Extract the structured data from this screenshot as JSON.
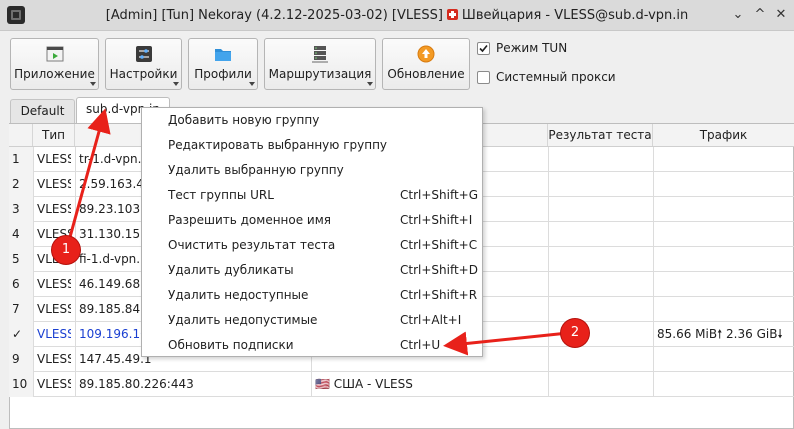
{
  "window": {
    "title_prefix": "[Admin] [Tun] Nekoray (4.2.12-2025-03-02) [VLESS]",
    "title_suffix": "Швейцария - VLESS@sub.d-vpn.in",
    "flag_icon": "swiss-flag-icon",
    "controls": [
      "⌄",
      "^",
      "✕"
    ]
  },
  "toolbar": {
    "buttons": [
      {
        "label": "Приложение",
        "icon": "application-icon",
        "dropdown": true
      },
      {
        "label": "Настройки",
        "icon": "settings-icon",
        "dropdown": true
      },
      {
        "label": "Профили",
        "icon": "profiles-folder-icon",
        "dropdown": true
      },
      {
        "label": "Маршрутизация",
        "icon": "routing-server-icon",
        "dropdown": true
      },
      {
        "label": "Обновление",
        "icon": "update-icon",
        "dropdown": false
      }
    ],
    "tun_mode": {
      "label": "Режим TUN",
      "checked": true
    },
    "system_proxy": {
      "label": "Системный прокси",
      "checked": false
    }
  },
  "tabs": [
    {
      "label": "Default",
      "active": false
    },
    {
      "label": "sub.d-vpn.in",
      "active": true
    }
  ],
  "table": {
    "columns": [
      "Тип",
      "",
      "",
      "Результат теста",
      "Трафик"
    ],
    "rows": [
      {
        "num": "1",
        "type": "VLESS",
        "address": "tr-1.d-vpn.in",
        "name": "",
        "test": "",
        "traffic": ""
      },
      {
        "num": "2",
        "type": "VLESS",
        "address": "2.59.163.42",
        "name": "",
        "test": "",
        "traffic": ""
      },
      {
        "num": "3",
        "type": "VLESS",
        "address": "89.23.103.2",
        "name": "",
        "test": "",
        "traffic": ""
      },
      {
        "num": "4",
        "type": "VLESS",
        "address": "31.130.152",
        "name": "",
        "test": "",
        "traffic": ""
      },
      {
        "num": "5",
        "type": "VLESS",
        "address": "fi-1.d-vpn.in",
        "name": "",
        "test": "",
        "traffic": ""
      },
      {
        "num": "6",
        "type": "VLESS",
        "address": "46.149.68.1",
        "name": "",
        "test": "",
        "traffic": ""
      },
      {
        "num": "7",
        "type": "VLESS",
        "address": "89.185.84.1",
        "name": "",
        "test": "",
        "traffic": ""
      },
      {
        "num": "✓",
        "type": "VLESS",
        "address": "109.196.10",
        "name": "",
        "test": "",
        "traffic": "85.66 MiB🠕 2.36 GiB🠗",
        "selected": true
      },
      {
        "num": "9",
        "type": "VLESS",
        "address": "147.45.49.1",
        "name": "",
        "test": "",
        "traffic": ""
      },
      {
        "num": "10",
        "type": "VLESS",
        "address": "89.185.80.226:443",
        "name": "🇺🇸 США - VLESS",
        "test": "",
        "traffic": ""
      }
    ]
  },
  "context_menu": {
    "items": [
      {
        "label": "Добавить новую группу",
        "shortcut": ""
      },
      {
        "label": "Редактировать выбранную группу",
        "shortcut": ""
      },
      {
        "label": "Удалить выбранную группу",
        "shortcut": ""
      },
      {
        "label": "Тест группы URL",
        "shortcut": "Ctrl+Shift+G"
      },
      {
        "label": "Разрешить доменное имя",
        "shortcut": "Ctrl+Shift+I"
      },
      {
        "label": "Очистить результат теста",
        "shortcut": "Ctrl+Shift+C"
      },
      {
        "label": "Удалить дубликаты",
        "shortcut": "Ctrl+Shift+D"
      },
      {
        "label": "Удалить недоступные",
        "shortcut": "Ctrl+Shift+R"
      },
      {
        "label": "Удалить недопустимые",
        "shortcut": "Ctrl+Alt+I"
      },
      {
        "label": "Обновить подписки",
        "shortcut": "Ctrl+U"
      }
    ]
  },
  "annotations": [
    {
      "label": "1",
      "color": "#e8211a"
    },
    {
      "label": "2",
      "color": "#e8211a"
    }
  ],
  "colors": {
    "accent_selected_text": "#1a3fd1",
    "annotation_red": "#e8211a"
  }
}
